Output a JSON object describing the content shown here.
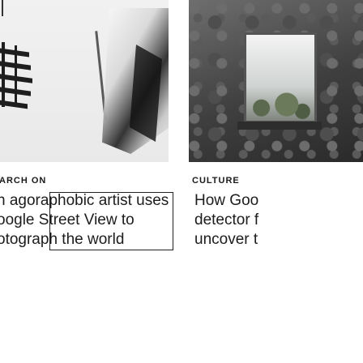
{
  "cards": [
    {
      "category": "ARCH ON",
      "headline_lines": [
        "n agoraphobic artist uses",
        "oogle Street View to",
        "otograph the world"
      ],
      "image_icon": "photo-thumbnail"
    },
    {
      "category": "CULTURE",
      "headline_lines": [
        "How Goo",
        "detector f",
        "uncover t"
      ],
      "image_icon": "photo-thumbnail"
    }
  ]
}
